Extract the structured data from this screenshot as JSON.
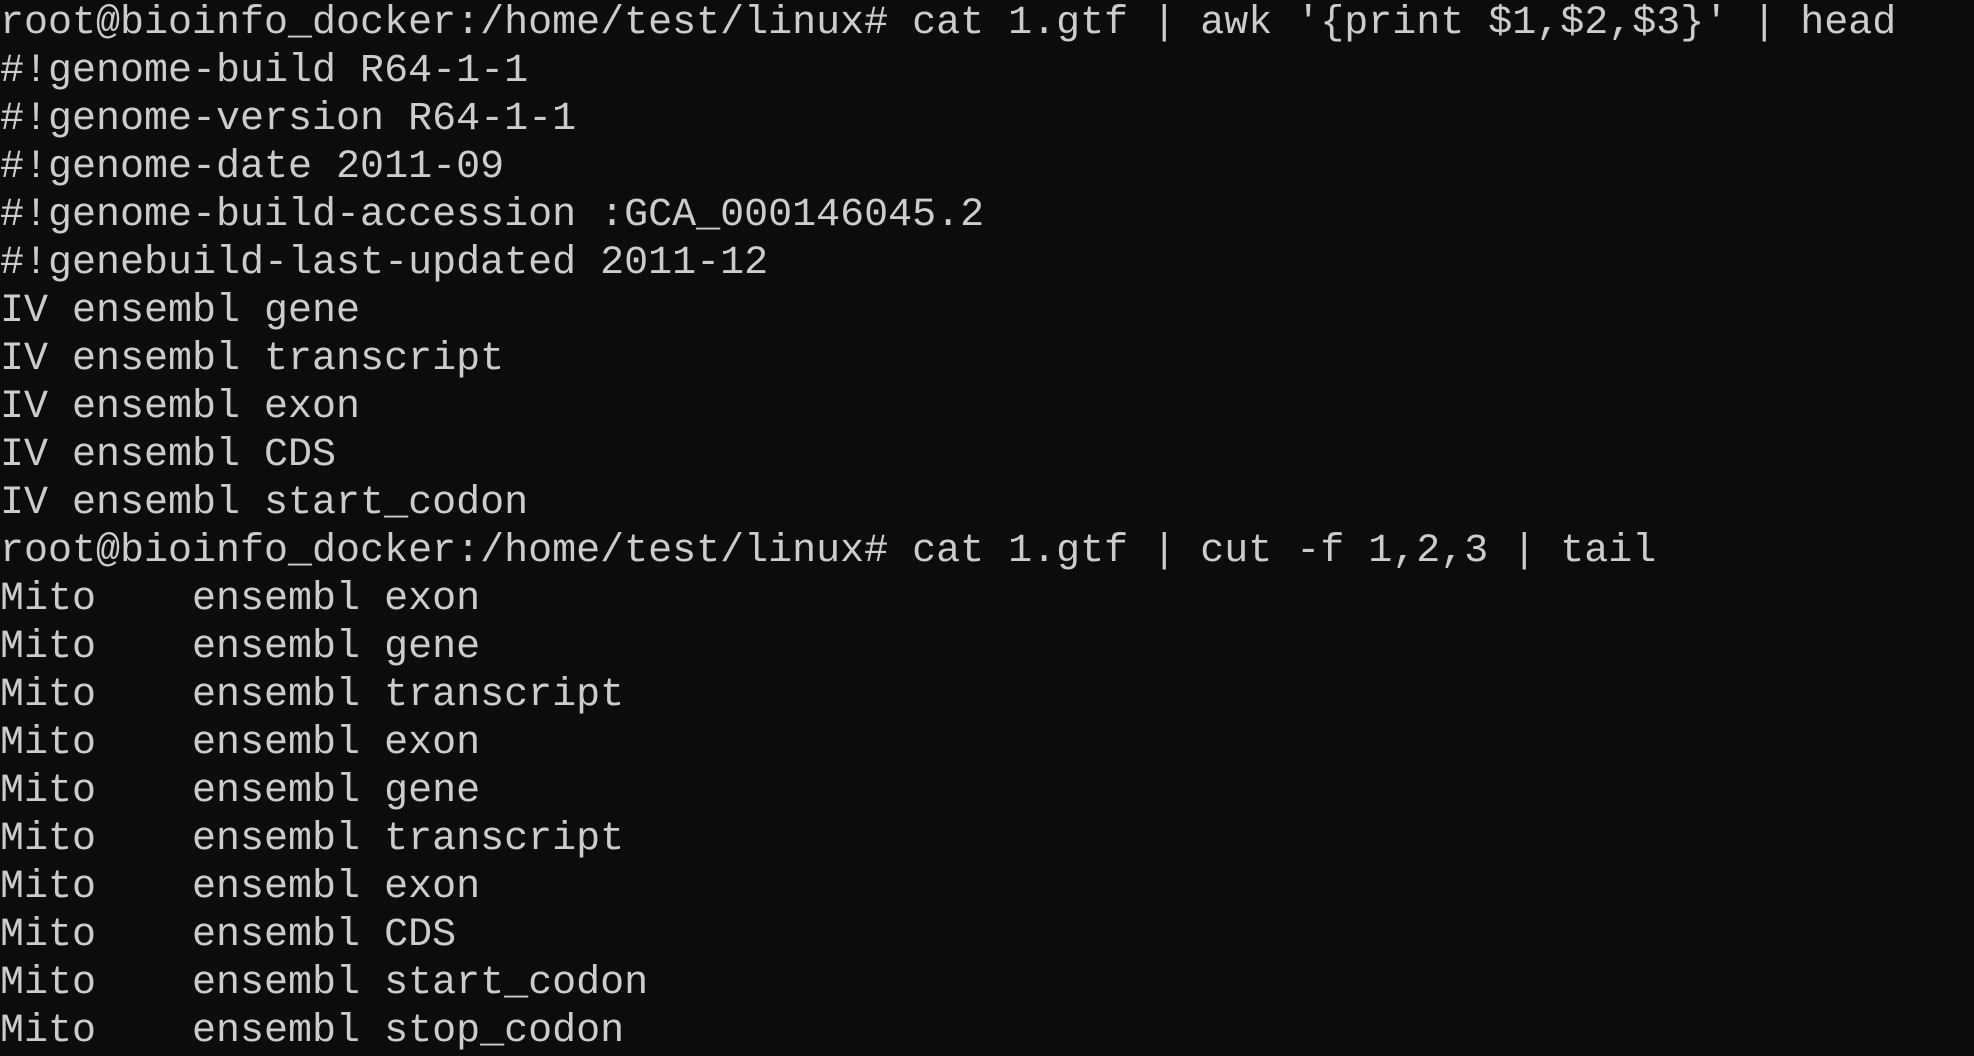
{
  "terminal": {
    "background": "#0c0c0c",
    "foreground": "#cccccc",
    "lines": [
      "root@bioinfo_docker:/home/test/linux# cat 1.gtf | awk '{print $1,$2,$3}' | head",
      "#!genome-build R64-1-1",
      "#!genome-version R64-1-1",
      "#!genome-date 2011-09",
      "#!genome-build-accession :GCA_000146045.2",
      "#!genebuild-last-updated 2011-12",
      "IV ensembl gene",
      "IV ensembl transcript",
      "IV ensembl exon",
      "IV ensembl CDS",
      "IV ensembl start_codon",
      "root@bioinfo_docker:/home/test/linux# cat 1.gtf | cut -f 1,2,3 | tail",
      "Mito\tensembl exon",
      "Mito\tensembl gene",
      "Mito\tensembl transcript",
      "Mito\tensembl exon",
      "Mito\tensembl gene",
      "Mito\tensembl transcript",
      "Mito\tensembl exon",
      "Mito\tensembl CDS",
      "Mito\tensembl start_codon",
      "Mito\tensembl stop_codon"
    ]
  }
}
